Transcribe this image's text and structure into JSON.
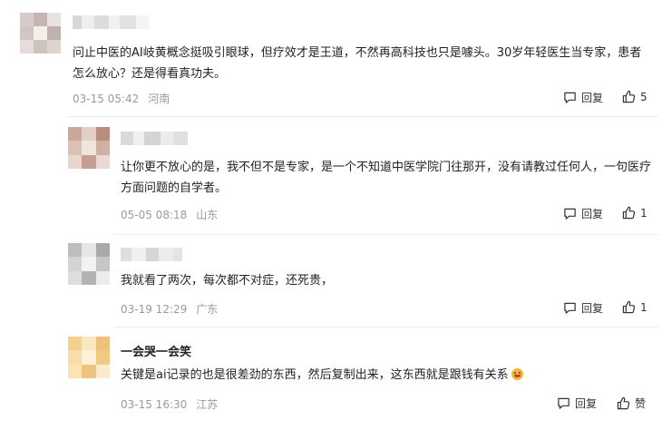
{
  "comments": [
    {
      "avatar_colors": [
        "#d8ccc8",
        "#c4b6b2",
        "#eae2df",
        "#d2c6c2",
        "#f4efed",
        "#bfb2ae",
        "#e6ddda",
        "#cfc3bf",
        "#ddd3cf"
      ],
      "username": "",
      "content": "问止中医的AI岐黄概念挺吸引眼球，但疗效才是王道，不然再高科技也只是噱头。30岁年轻医生当专家，患者怎么放心？还是得看真功夫。",
      "time": "03-15 05:42",
      "location": "河南",
      "reply_label": "回复",
      "like_count": "5"
    },
    {
      "avatar_colors": [
        "#c9a79a",
        "#e4cfc6",
        "#b98e80",
        "#dcc0b4",
        "#f1e4de",
        "#cfb0a4",
        "#e8d6cf",
        "#c49f92",
        "#ead9d2"
      ],
      "username": "",
      "content": "让你更不放心的是，我不但不是专家，是一个不知道中医学院门往那开，没有请教过任何人，一句医疗方面问题的自学者。",
      "time": "05-05 08:18",
      "location": "山东",
      "reply_label": "回复",
      "like_count": "1"
    },
    {
      "avatar_colors": [
        "#bdbdbd",
        "#e6e6e6",
        "#a9a9a9",
        "#d3d3d3",
        "#f2f2f2",
        "#c6c6c6",
        "#dedede",
        "#b3b3b3",
        "#ececec"
      ],
      "username": "",
      "content": "我就看了两次，每次都不对症，还死贵，",
      "time": "03-19 12:29",
      "location": "广东",
      "reply_label": "回复",
      "like_count": "1"
    },
    {
      "avatar_colors": [
        "#f3d08f",
        "#fbe8c2",
        "#eec27a",
        "#f8dda6",
        "#fff1d6",
        "#f1c982",
        "#fae3b4",
        "#efc47e",
        "#fbeacb"
      ],
      "username": "一会哭一会笑",
      "content": "关键是ai记录的也是很差劲的东西，然后复制出来，这东西就是跟钱有关系",
      "time": "03-15 16:30",
      "location": "江苏",
      "reply_label": "回复",
      "like_count": "赞"
    }
  ]
}
